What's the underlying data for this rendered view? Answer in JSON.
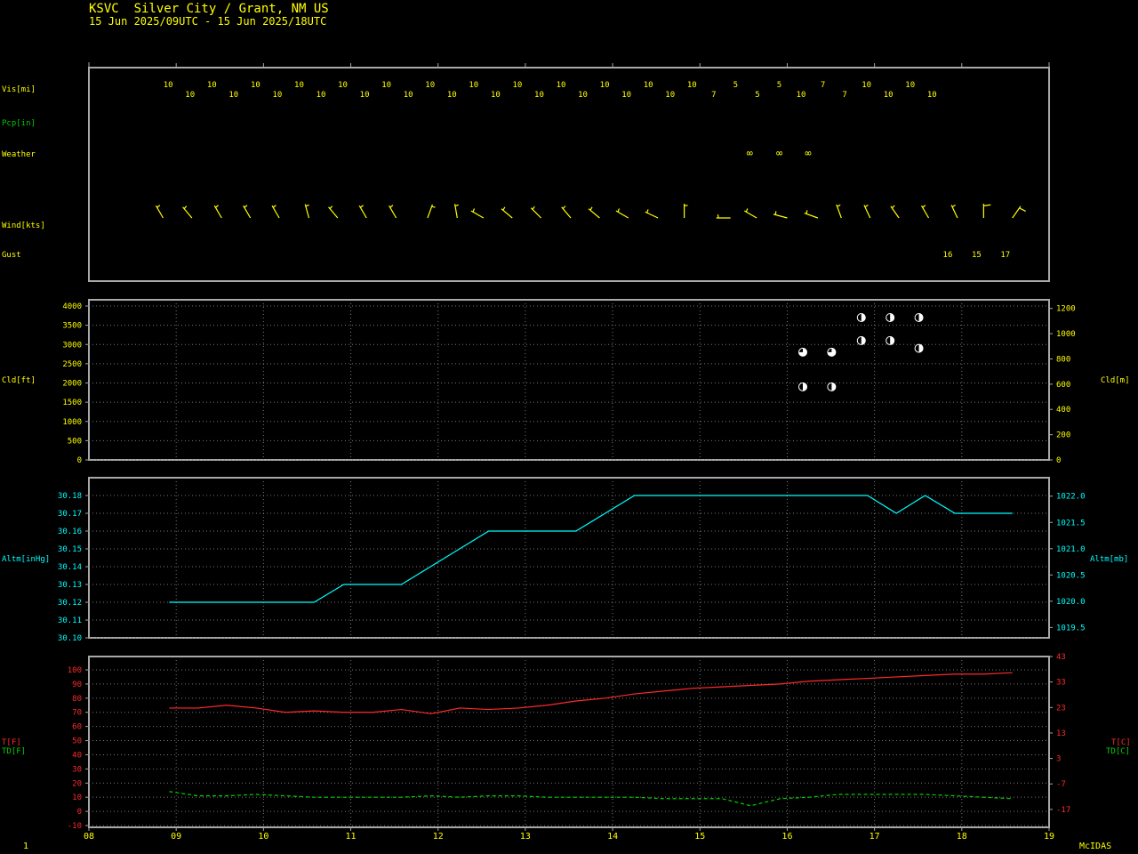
{
  "header": {
    "station": "KSVC  Silver City / Grant, NM US",
    "period": "15 Jun 2025/09UTC - 15 Jun 2025/18UTC"
  },
  "footer": {
    "page": "1",
    "brand": "McIDAS"
  },
  "colors": {
    "frame": "#a8a8a8",
    "text": "#ffff00",
    "pcp": "#00c800",
    "altim": "#00ffff",
    "temp": "#ff2a2a",
    "dew": "#00d000",
    "cloud": "#ffffff",
    "grid": "#777777"
  },
  "labels": {
    "vis": "Vis[mi]",
    "pcp": "Pcp[in]",
    "weather": "Weather",
    "wind": "Wind[kts]",
    "gust": "Gust",
    "cld_left": "Cld[ft]",
    "cld_right": "Cld[m]",
    "alt_left": "Altm[inHg]",
    "alt_right": "Altm[mb]",
    "t_left": "T[F]",
    "td_left": "TD[F]",
    "t_right": "T[C]",
    "td_right": "TD[C]"
  },
  "chart_data": [
    {
      "type": "table",
      "panel": "surface-obs",
      "x_hours": [
        9.0,
        9.25,
        9.5,
        9.75,
        10.0,
        10.25,
        10.5,
        10.75,
        11.0,
        11.25,
        11.5,
        11.75,
        12.0,
        12.25,
        12.5,
        12.75,
        13.0,
        13.25,
        13.5,
        13.75,
        14.0,
        14.25,
        14.5,
        14.75,
        15.0,
        15.25,
        15.5,
        15.75,
        16.0,
        16.25,
        16.5,
        16.75,
        17.0,
        17.25,
        17.5,
        17.75
      ],
      "visibility": [
        "10",
        "10",
        "10",
        "10",
        "10",
        "10",
        "10",
        "10",
        "10",
        "10",
        "10",
        "10",
        "10",
        "10",
        "10",
        "10",
        "10",
        "10",
        "10",
        "10",
        "10",
        "10",
        "10",
        "10",
        "10",
        "7",
        "5",
        "5",
        "5",
        "10",
        "7",
        "7",
        "10",
        "10",
        "10",
        "10"
      ],
      "weather_hours": [
        15.58,
        15.92,
        16.25
      ],
      "weather_symbol": "∞",
      "wind": [
        {
          "x": 8.85,
          "dir": 330,
          "spd": 5
        },
        {
          "x": 9.18,
          "dir": 320,
          "spd": 5
        },
        {
          "x": 9.52,
          "dir": 330,
          "spd": 5
        },
        {
          "x": 9.85,
          "dir": 330,
          "spd": 5
        },
        {
          "x": 10.18,
          "dir": 330,
          "spd": 5
        },
        {
          "x": 10.52,
          "dir": 345,
          "spd": 5
        },
        {
          "x": 10.85,
          "dir": 320,
          "spd": 5
        },
        {
          "x": 11.18,
          "dir": 330,
          "spd": 5
        },
        {
          "x": 11.52,
          "dir": 330,
          "spd": 5
        },
        {
          "x": 11.88,
          "dir": 20,
          "spd": 5
        },
        {
          "x": 12.22,
          "dir": 350,
          "spd": 5
        },
        {
          "x": 12.52,
          "dir": 300,
          "spd": 5
        },
        {
          "x": 12.85,
          "dir": 310,
          "spd": 5
        },
        {
          "x": 13.18,
          "dir": 315,
          "spd": 5
        },
        {
          "x": 13.52,
          "dir": 320,
          "spd": 5
        },
        {
          "x": 13.85,
          "dir": 310,
          "spd": 5
        },
        {
          "x": 14.18,
          "dir": 300,
          "spd": 5
        },
        {
          "x": 14.52,
          "dir": 295,
          "spd": 5
        },
        {
          "x": 14.82,
          "dir": 360,
          "spd": 6
        },
        {
          "x": 15.35,
          "dir": 270,
          "spd": 6
        },
        {
          "x": 15.65,
          "dir": 300,
          "spd": 5
        },
        {
          "x": 16.0,
          "dir": 285,
          "spd": 6
        },
        {
          "x": 16.35,
          "dir": 290,
          "spd": 6
        },
        {
          "x": 16.62,
          "dir": 340,
          "spd": 6
        },
        {
          "x": 16.95,
          "dir": 335,
          "spd": 8
        },
        {
          "x": 17.28,
          "dir": 325,
          "spd": 8
        },
        {
          "x": 17.62,
          "dir": 330,
          "spd": 7
        },
        {
          "x": 17.95,
          "dir": 335,
          "spd": 7
        },
        {
          "x": 18.25,
          "dir": 360,
          "spd": 10
        },
        {
          "x": 18.58,
          "dir": 35,
          "spd": 10
        }
      ],
      "gust_hours": [
        17.92,
        18.25,
        18.58
      ],
      "gust_values": [
        "16",
        "15",
        "17"
      ]
    },
    {
      "type": "scatter",
      "panel": "cloud-heights",
      "ylabel": "Cld[ft]",
      "y2label": "Cld[m]",
      "ylim": [
        0,
        4000
      ],
      "yticks": [
        0,
        500,
        1000,
        1500,
        2000,
        2500,
        3000,
        3500,
        4000
      ],
      "y2ticks": [
        "0",
        "200",
        "400",
        "600",
        "800",
        "1000",
        "1200"
      ],
      "points": [
        {
          "x": 16.25,
          "y": 2800,
          "cover": "sct"
        },
        {
          "x": 16.58,
          "y": 2800,
          "cover": "sct"
        },
        {
          "x": 16.25,
          "y": 1900,
          "cover": "bkn"
        },
        {
          "x": 16.58,
          "y": 1900,
          "cover": "bkn"
        },
        {
          "x": 16.92,
          "y": 3700,
          "cover": "bkn"
        },
        {
          "x": 17.25,
          "y": 3700,
          "cover": "bkn"
        },
        {
          "x": 17.58,
          "y": 3700,
          "cover": "bkn"
        },
        {
          "x": 16.92,
          "y": 3100,
          "cover": "bkn"
        },
        {
          "x": 17.25,
          "y": 3100,
          "cover": "bkn"
        },
        {
          "x": 17.58,
          "y": 2900,
          "cover": "bkn"
        }
      ]
    },
    {
      "type": "line",
      "panel": "altimeter",
      "ylabel": "Altm[inHg]",
      "y2label": "Altm[mb]",
      "ylim": [
        30.1,
        30.185
      ],
      "yticks": [
        "30.10",
        "30.11",
        "30.12",
        "30.13",
        "30.14",
        "30.15",
        "30.16",
        "30.17",
        "30.18"
      ],
      "y2ticks": [
        "1019.5",
        "1020.0",
        "1020.5",
        "1021.0",
        "1021.5",
        "1022.0"
      ],
      "x": [
        8.92,
        10.58,
        10.92,
        11.58,
        12.58,
        13.58,
        14.25,
        16.92,
        17.25,
        17.58,
        17.92,
        18.58
      ],
      "values": [
        30.12,
        30.12,
        30.13,
        30.13,
        30.16,
        30.16,
        30.18,
        30.18,
        30.17,
        30.18,
        30.17,
        30.17
      ]
    },
    {
      "type": "line",
      "panel": "temperature",
      "ylabel": "T[F]",
      "y2label": "T[C]",
      "ylim": [
        -10,
        105
      ],
      "yticks": [
        "-10",
        "0",
        "10",
        "20",
        "30",
        "40",
        "50",
        "60",
        "70",
        "80",
        "90",
        "100"
      ],
      "y2ticks": [
        "-17",
        "-7",
        "3",
        "13",
        "23",
        "33",
        "43"
      ],
      "xlim": [
        8,
        19
      ],
      "xticks": [
        "08",
        "09",
        "10",
        "11",
        "12",
        "13",
        "14",
        "15",
        "16",
        "17",
        "18",
        "19"
      ],
      "x": [
        8.92,
        9.25,
        9.58,
        9.92,
        10.25,
        10.58,
        10.92,
        11.25,
        11.58,
        11.92,
        12.25,
        12.58,
        12.92,
        13.25,
        13.58,
        13.92,
        14.25,
        14.58,
        14.92,
        15.25,
        15.58,
        15.92,
        16.25,
        16.58,
        16.92,
        17.25,
        17.58,
        17.92,
        18.25,
        18.58
      ],
      "series": [
        {
          "name": "T[F]",
          "values": [
            73,
            73,
            75,
            73,
            70,
            71,
            70,
            70,
            72,
            69,
            73,
            72,
            73,
            75,
            78,
            80,
            83,
            85,
            87,
            88,
            89,
            90,
            92,
            93,
            94,
            95,
            96,
            97,
            97,
            98
          ]
        },
        {
          "name": "TD[F]",
          "values": [
            14,
            11,
            11,
            12,
            11,
            10,
            10,
            10,
            10,
            11,
            10,
            11,
            11,
            10,
            10,
            10,
            10,
            9,
            9,
            9,
            4,
            9,
            10,
            12,
            12,
            12,
            12,
            11,
            10,
            9
          ]
        }
      ]
    }
  ]
}
